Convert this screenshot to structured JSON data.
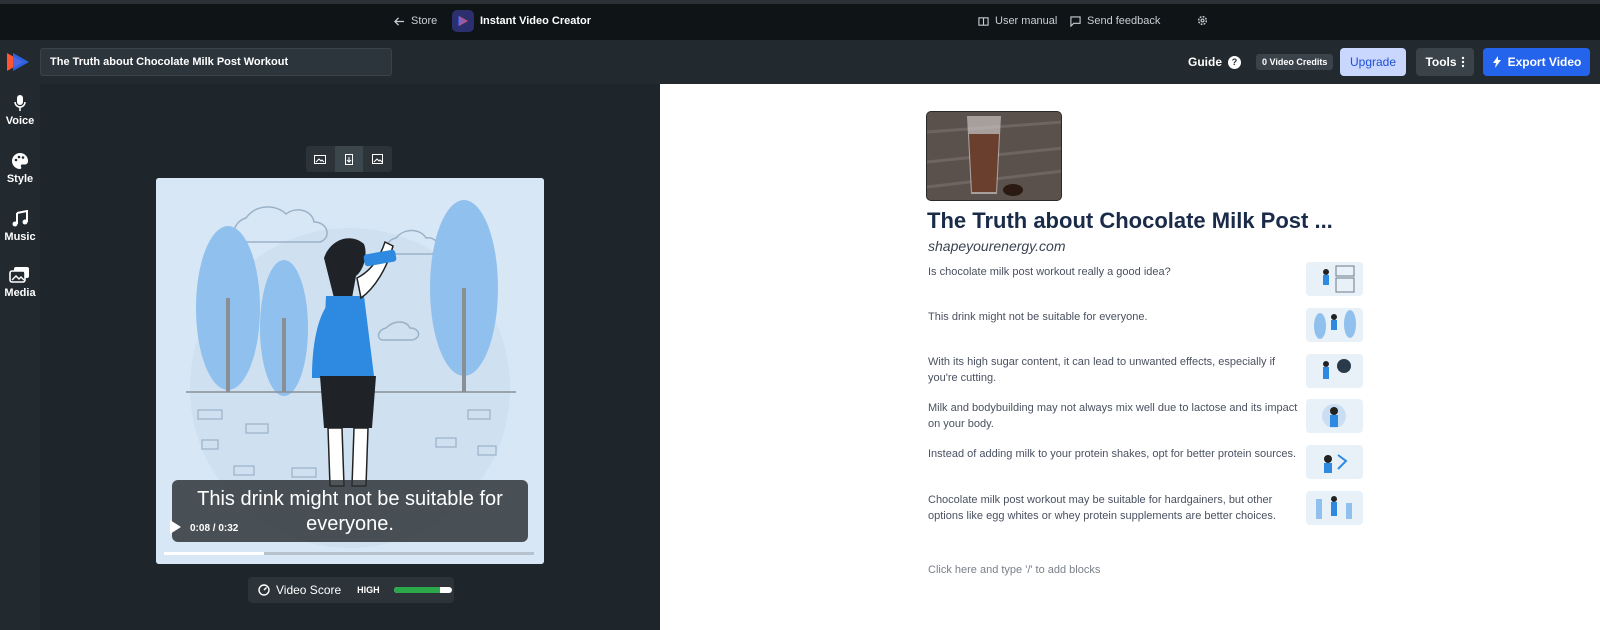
{
  "topbar": {
    "store_label": "Store",
    "app_name": "Instant Video Creator",
    "user_manual_label": "User manual",
    "send_feedback_label": "Send feedback"
  },
  "header": {
    "project_title": "The Truth about Chocolate Milk Post Workout",
    "guide_label": "Guide",
    "guide_icon": "?",
    "credits_label": "0 Video Credits",
    "upgrade_label": "Upgrade",
    "tools_label": "Tools",
    "export_label": "Export Video"
  },
  "sidebar": {
    "items": [
      {
        "label": "Voice",
        "icon": "microphone-icon"
      },
      {
        "label": "Style",
        "icon": "palette-icon"
      },
      {
        "label": "Music",
        "icon": "music-note-icon"
      },
      {
        "label": "Media",
        "icon": "images-icon"
      }
    ]
  },
  "player": {
    "caption": "This drink might not be suitable for everyone.",
    "time": "0:08 / 0:32",
    "progress": 0.27,
    "score_label": "Video Score",
    "score_level": "HIGH",
    "score_fill": 0.8
  },
  "document": {
    "title": "The Truth about Chocolate Milk Post ...",
    "source": "shapeyourenergy.com",
    "blocks": [
      "Is chocolate milk post workout really a good idea?",
      "This drink might not be suitable for everyone.",
      "With its high sugar content, it can lead to unwanted effects, especially if you're cutting.",
      "Milk and bodybuilding may not always mix well due to lactose and its impact on your body.",
      "Instead of adding milk to your protein shakes, opt for better protein sources.",
      "Chocolate milk post workout may be suitable for hardgainers, but other options like egg whites or whey protein supplements are better choices."
    ],
    "hint": "Click here and type '/' to add blocks"
  },
  "colors": {
    "accent": "#2463eb",
    "upgrade_bg": "#c9d7ff",
    "score_green": "#2aa84a"
  }
}
